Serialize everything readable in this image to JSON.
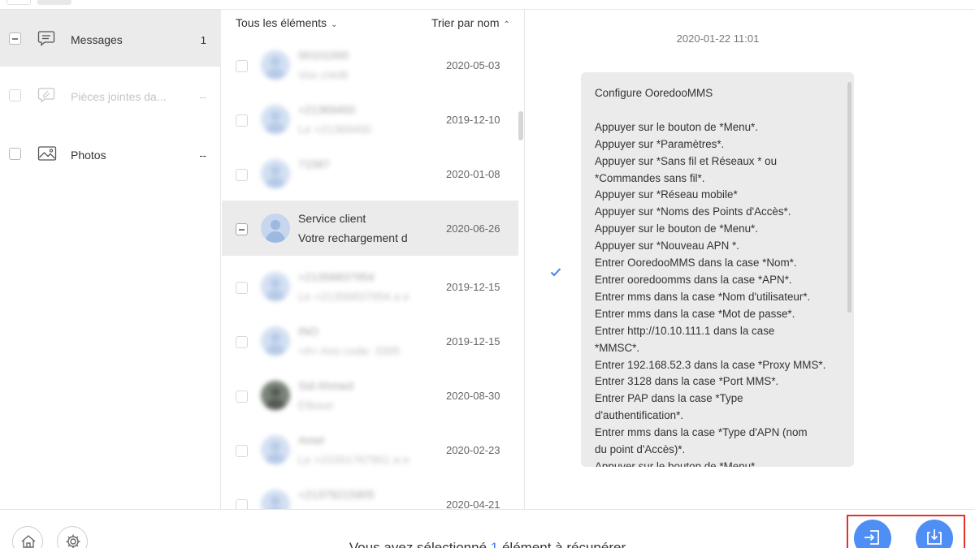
{
  "sidebar": {
    "items": [
      {
        "label": "Messages",
        "count": "1",
        "icon": "message-icon",
        "state": "partial"
      },
      {
        "label": "Pièces jointes da...",
        "count": "--",
        "icon": "attachment-icon",
        "state": "disabled"
      },
      {
        "label": "Photos",
        "count": "--",
        "icon": "photo-icon",
        "state": "empty"
      }
    ]
  },
  "list": {
    "filter_label": "Tous les éléments",
    "sort_label": "Trier par nom",
    "rows": [
      {
        "name": "00101000",
        "preview": "Vos crédit",
        "date": "2020-05-03"
      },
      {
        "name": "+21369450",
        "preview": "Le +21369450",
        "date": "2019-12-10"
      },
      {
        "name": "71587",
        "preview": "",
        "date": "2020-01-08"
      },
      {
        "name": "Service client",
        "preview": "Votre rechargement d",
        "date": "2020-06-26"
      },
      {
        "name": "+21356837954",
        "preview": "Le +21356837954 a e",
        "date": "2019-12-15"
      },
      {
        "name": "INO",
        "preview": "<#> Ano code: 3395",
        "date": "2019-12-15"
      },
      {
        "name": "Sid Ahmed",
        "preview": "Elboun",
        "date": "2020-08-30"
      },
      {
        "name": "Amel",
        "preview": "Le +21551767951 a e",
        "date": "2020-02-23"
      },
      {
        "name": "+21379215905",
        "preview": "",
        "date": "2020-04-21"
      }
    ]
  },
  "detail": {
    "timestamp": "2020-01-22 11:01",
    "message": "Configure OoredooMMS\n\nAppuyer sur le bouton de *Menu*.\nAppuyer sur *Paramètres*.\nAppuyer sur *Sans fil et Réseaux * ou\n*Commandes sans fil*.\nAppuyer sur *Réseau mobile*\nAppuyer sur *Noms des Points d'Accès*.\nAppuyer sur le bouton de *Menu*.\nAppuyer sur *Nouveau APN *.\nEntrer OoredooMMS dans la case *Nom*.\nEntrer ooredoomms dans la case *APN*.\nEntrer mms dans la case *Nom d'utilisateur*.\nEntrer mms dans la case *Mot de passe*.\nEntrer http://10.10.111.1 dans la case\n*MMSC*.\nEntrer 192.168.52.3 dans la case *Proxy MMS*.\nEntrer 3128 dans la case *Port MMS*.\nEntrer PAP dans la case *Type\nd'authentification*.\nEntrer mms dans la case *Type d'APN (nom\ndu point d'Accès)*.\nAppuyer sur le bouton de *Menu*."
  },
  "footer": {
    "status_prefix": "Vous avez sélectionné ",
    "status_count": "1",
    "status_suffix": " élément à récupérer",
    "home_icon": "home-icon",
    "settings_icon": "gear-icon",
    "accent_color": "#4f8ef5",
    "highlight_color": "#e5312a"
  }
}
